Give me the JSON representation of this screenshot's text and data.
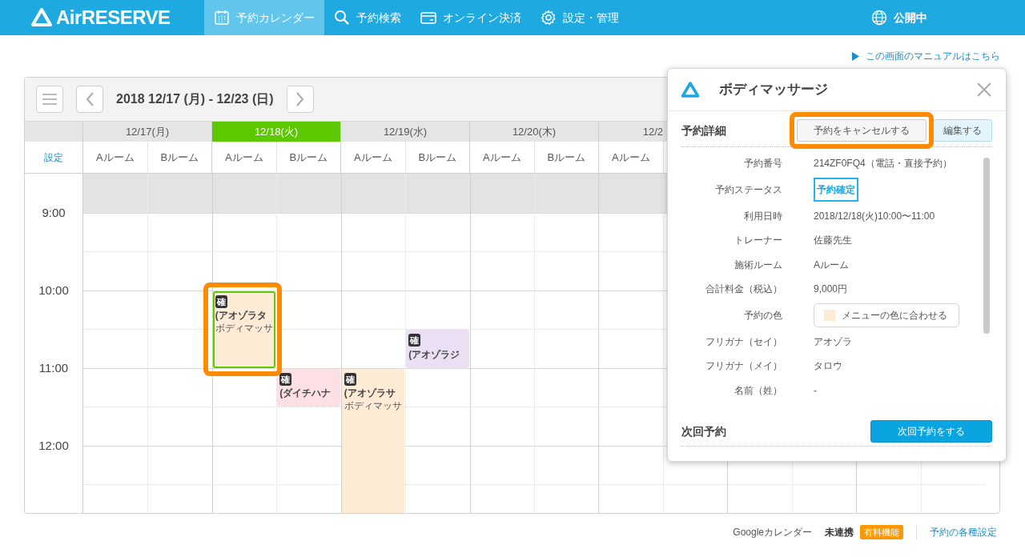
{
  "app": {
    "logo": "AirRESERVE",
    "nav": [
      {
        "label": "予約カレンダー",
        "selected": true
      },
      {
        "label": "予約検索",
        "selected": false
      },
      {
        "label": "オンライン決済",
        "selected": false
      },
      {
        "label": "設定・管理",
        "selected": false
      }
    ],
    "status": "公開中"
  },
  "manual_link": "この画面のマニュアルはこちら",
  "calendar": {
    "range": "2018 12/17 (月) - 12/23 (日)",
    "settings_link": "設定",
    "times": [
      "9:00",
      "10:00",
      "11:00",
      "12:00"
    ],
    "days": [
      {
        "label": "12/17(月)",
        "selected": false,
        "rooms": [
          {
            "label": "Aルーム"
          },
          {
            "label": "Bルーム"
          }
        ]
      },
      {
        "label": "12/18(火)",
        "selected": true,
        "rooms": [
          {
            "label": "Aルーム",
            "events": [
              {
                "kind": "ten-hour",
                "badge": "確",
                "name": "(アオゾラタ",
                "menu": "ボディマッサ",
                "color": "#fdebd6",
                "selected": true,
                "highlighted": true
              }
            ]
          },
          {
            "label": "Bルーム",
            "events": [
              {
                "kind": "eleven-half",
                "badge": "確",
                "name": "(ダイチハナ",
                "color": "#fde0e4",
                "selected": false,
                "highlighted": false
              }
            ]
          }
        ]
      },
      {
        "label": "12/19(水)",
        "selected": false,
        "rooms": [
          {
            "label": "Aルーム",
            "events": [
              {
                "kind": "eleven-long",
                "badge": "確",
                "name": "(アオゾラサ",
                "menu": "ボディマッサ",
                "color": "#fdebd6",
                "selected": false,
                "highlighted": false
              }
            ]
          },
          {
            "label": "Bルーム",
            "events": [
              {
                "kind": "tenthirty-half",
                "badge": "確",
                "name": "(アオゾラジ",
                "color": "#ebe0f3",
                "selected": false,
                "highlighted": false
              }
            ]
          }
        ]
      },
      {
        "label": "12/20(木)",
        "selected": false,
        "rooms": [
          {
            "label": "Aルーム"
          },
          {
            "label": "Bルーム"
          }
        ]
      },
      {
        "label": "12/2",
        "selected": false,
        "rooms": [
          {
            "label": "Aルーム"
          }
        ]
      }
    ]
  },
  "popup": {
    "title": "ボディマッサージ",
    "section": "予約詳細",
    "buttons": [
      {
        "label": "予約をキャンセルする",
        "kind": "cancel",
        "highlighted": true
      },
      {
        "label": "編集する",
        "kind": "edit",
        "highlighted": false
      }
    ],
    "fields": [
      {
        "kind": "text",
        "label": "予約番号",
        "value": "214ZF0FQ4（電話・直接予約）"
      },
      {
        "kind": "status",
        "label": "予約ステータス",
        "value": "予約確定"
      },
      {
        "kind": "text",
        "label": "利用日時",
        "value": "2018/12/18(火)10:00〜11:00"
      },
      {
        "kind": "text",
        "label": "トレーナー",
        "value": "佐藤先生"
      },
      {
        "kind": "text",
        "label": "施術ルーム",
        "value": "Aルーム"
      },
      {
        "kind": "text",
        "label": "合計料金（税込）",
        "value": "9,000円"
      },
      {
        "kind": "color",
        "label": "予約の色",
        "value": "メニューの色に合わせる",
        "color": "#fdebd6"
      },
      {
        "kind": "text",
        "label": "フリガナ（セイ）",
        "value": "アオゾラ"
      },
      {
        "kind": "text",
        "label": "フリガナ（メイ）",
        "value": "タロウ"
      },
      {
        "kind": "text",
        "label": "名前（姓）",
        "value": "-"
      }
    ],
    "next": {
      "title": "次回予約",
      "button": "次回予約をする"
    }
  },
  "footer": {
    "google_label": "Googleカレンダー",
    "google_status": "未連携",
    "paid_badge": "有料機能",
    "settings_link": "予約の各種設定"
  }
}
